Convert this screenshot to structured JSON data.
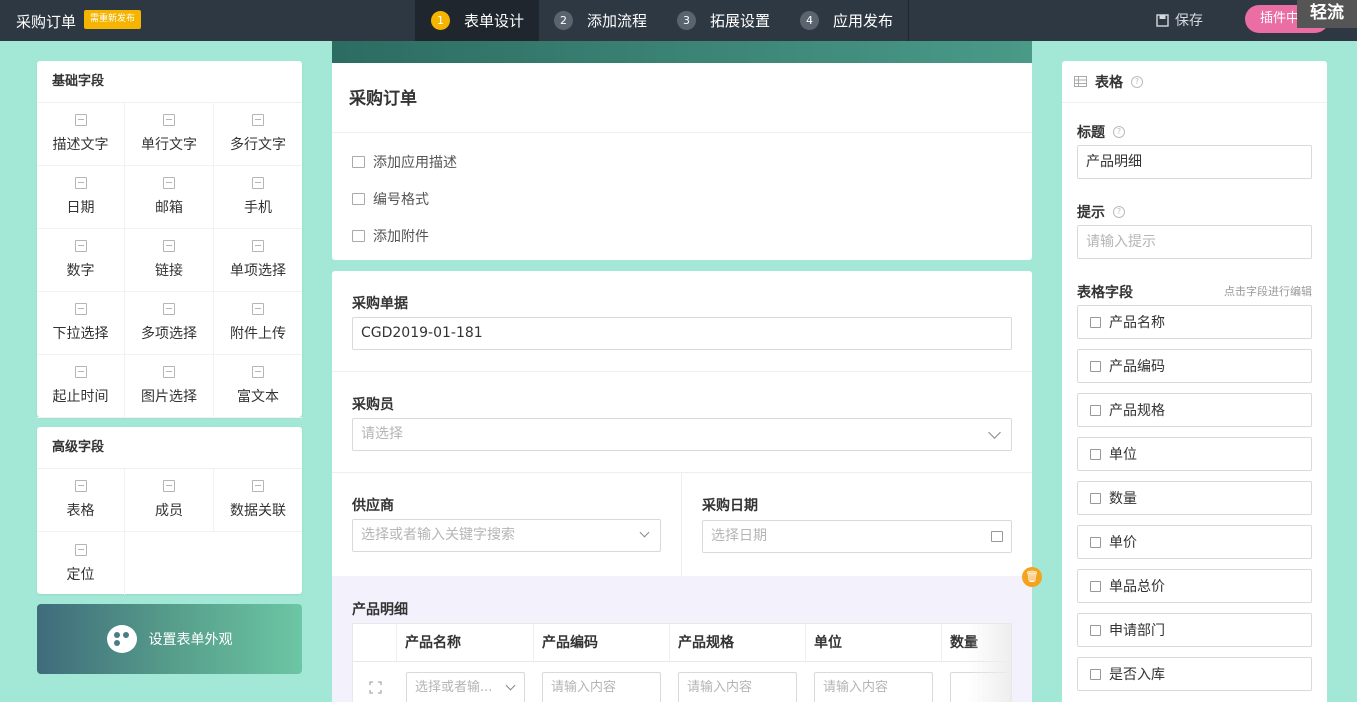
{
  "topbar": {
    "title": "采购订单",
    "badge": "需重新发布",
    "steps": [
      {
        "num": "1",
        "label": "表单设计"
      },
      {
        "num": "2",
        "label": "添加流程"
      },
      {
        "num": "3",
        "label": "拓展设置"
      },
      {
        "num": "4",
        "label": "应用发布"
      }
    ],
    "save_label": "保存",
    "plugin_label": "插件中心",
    "logo": "轻流"
  },
  "basic_fields": {
    "title": "基础字段",
    "items": [
      "描述文字",
      "单行文字",
      "多行文字",
      "日期",
      "邮箱",
      "手机",
      "数字",
      "链接",
      "单项选择",
      "下拉选择",
      "多项选择",
      "附件上传",
      "起止时间",
      "图片选择",
      "富文本"
    ]
  },
  "advanced_fields": {
    "title": "高级字段",
    "items": [
      "表格",
      "成员",
      "数据关联",
      "定位"
    ]
  },
  "appearance_label": "设置表单外观",
  "form": {
    "title": "采购订单",
    "links": [
      "添加应用描述",
      "编号格式",
      "添加附件"
    ],
    "order_no_label": "采购单据",
    "order_no_value": "CGD2019-01-181",
    "buyer_label": "采购员",
    "buyer_placeholder": "请选择",
    "supplier_label": "供应商",
    "supplier_placeholder": "选择或者输入关键字搜索",
    "date_label": "采购日期",
    "date_placeholder": "选择日期",
    "table_label": "产品明细",
    "table_columns": [
      "产品名称",
      "产品编码",
      "产品规格",
      "单位",
      "数量"
    ],
    "row_placeholders": [
      "选择或者输...",
      "请输入内容",
      "请输入内容",
      "请输入内容"
    ]
  },
  "props": {
    "header": "表格",
    "title_label": "标题",
    "title_value": "产品明细",
    "tip_label": "提示",
    "tip_placeholder": "请输入提示",
    "fields_label": "表格字段",
    "fields_hint": "点击字段进行编辑",
    "fields": [
      "产品名称",
      "产品编码",
      "产品规格",
      "单位",
      "数量",
      "单价",
      "单品总价",
      "申请部门",
      "是否入库"
    ]
  }
}
